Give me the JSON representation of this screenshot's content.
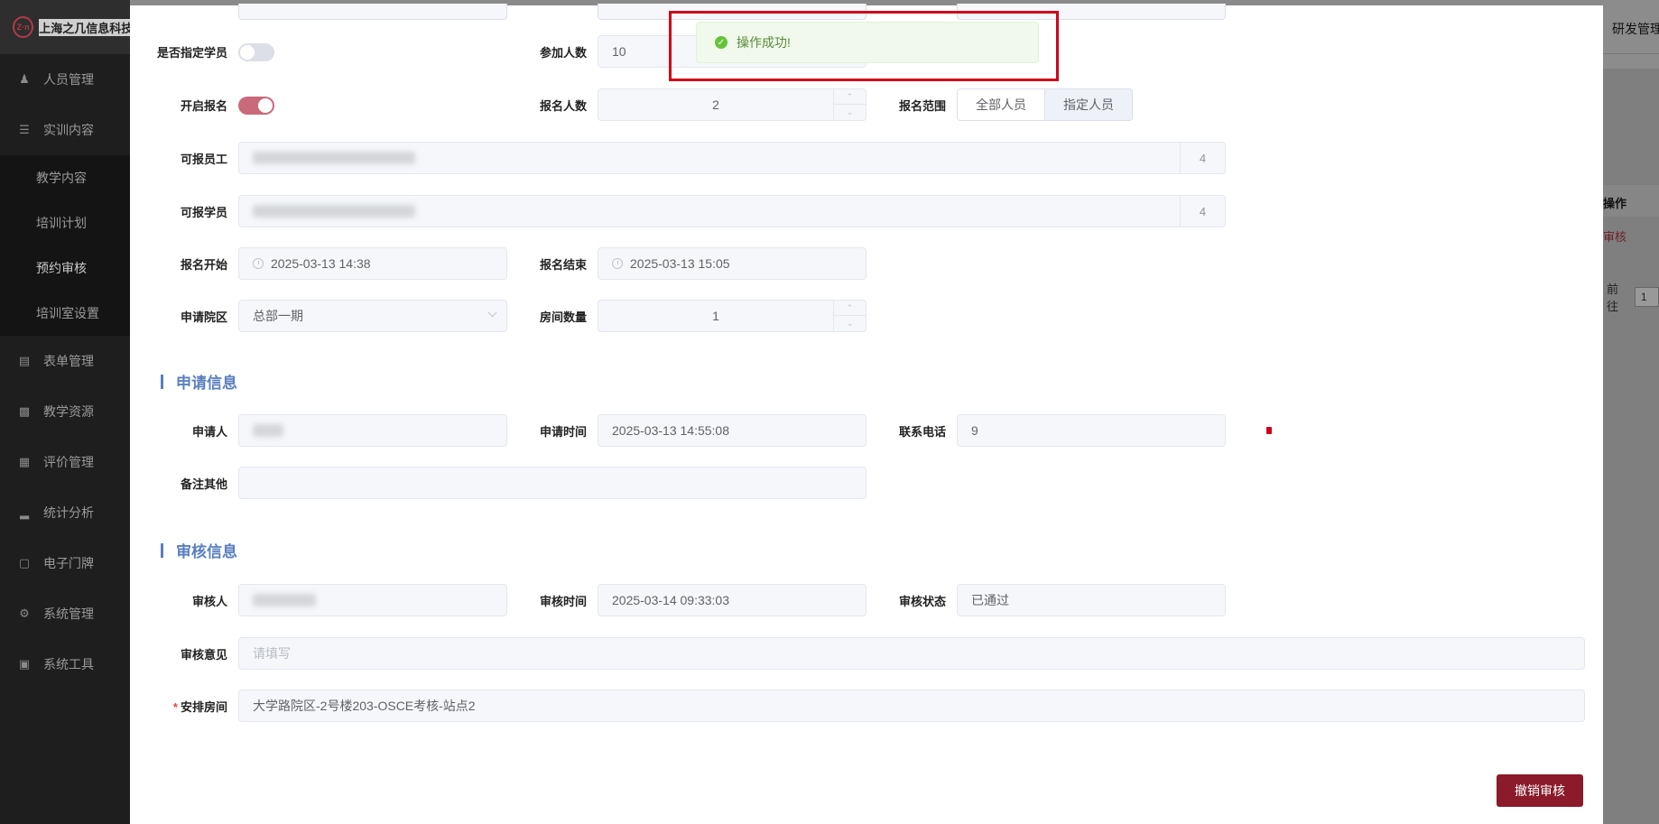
{
  "brand": {
    "logo_text": "Z·n",
    "name": "上海之几信息科技有限公司"
  },
  "sidebar": {
    "items": [
      {
        "icon": "users-icon",
        "label": "人员管理"
      },
      {
        "icon": "training-icon",
        "label": "实训内容"
      }
    ],
    "subitems": [
      {
        "label": "教学内容"
      },
      {
        "label": "培训计划"
      },
      {
        "label": "预约审核",
        "active": true
      },
      {
        "label": "培训室设置"
      }
    ],
    "items_after": [
      {
        "icon": "form-icon",
        "label": "表单管理"
      },
      {
        "icon": "resource-icon",
        "label": "教学资源"
      },
      {
        "icon": "evaluation-icon",
        "label": "评价管理"
      },
      {
        "icon": "chart-icon",
        "label": "统计分析"
      },
      {
        "icon": "monitor-icon",
        "label": "电子门牌"
      },
      {
        "icon": "gear-icon",
        "label": "系统管理"
      },
      {
        "icon": "toolbox-icon",
        "label": "系统工具"
      }
    ]
  },
  "right_panel": {
    "topbar_label": "研发管理",
    "table_header": "操作",
    "row_action": "审核",
    "pager_label": "前往",
    "pager_value": "1"
  },
  "toast": {
    "message": "操作成功!",
    "icon": "check-circle-icon"
  },
  "form": {
    "designated_students_label": "是否指定学员",
    "designated_students_on": false,
    "participants_label": "参加人数",
    "participants_value": "10",
    "open_registration_label": "开启报名",
    "open_registration_on": true,
    "registered_count_label": "报名人数",
    "registered_count_value": "2",
    "registration_scope_label": "报名范围",
    "scope_options": [
      "全部人员",
      "指定人员"
    ],
    "scope_selected": "指定人员",
    "eligible_staff_label": "可报员工",
    "eligible_staff_count": "4",
    "eligible_students_label": "可报学员",
    "eligible_students_count": "4",
    "registration_start_label": "报名开始",
    "registration_start_value": "2025-03-13 14:38",
    "registration_end_label": "报名结束",
    "registration_end_value": "2025-03-13 15:05",
    "campus_label": "申请院区",
    "campus_value": "总部一期",
    "room_count_label": "房间数量",
    "room_count_value": "1"
  },
  "application": {
    "section_title": "申请信息",
    "applicant_label": "申请人",
    "apply_time_label": "申请时间",
    "apply_time_value": "2025-03-13 14:55:08",
    "phone_label": "联系电话",
    "phone_value": "9",
    "remarks_label": "备注其他"
  },
  "review": {
    "section_title": "审核信息",
    "reviewer_label": "审核人",
    "review_time_label": "审核时间",
    "review_time_value": "2025-03-14 09:33:03",
    "review_status_label": "审核状态",
    "review_status_value": "已通过",
    "review_opinion_label": "审核意见",
    "review_opinion_placeholder": "请填写",
    "room_label": "安排房间",
    "room_value": "大学路院区-2号楼203-OSCE考核-站点2"
  },
  "actions": {
    "revoke_label": "撤销审核"
  }
}
